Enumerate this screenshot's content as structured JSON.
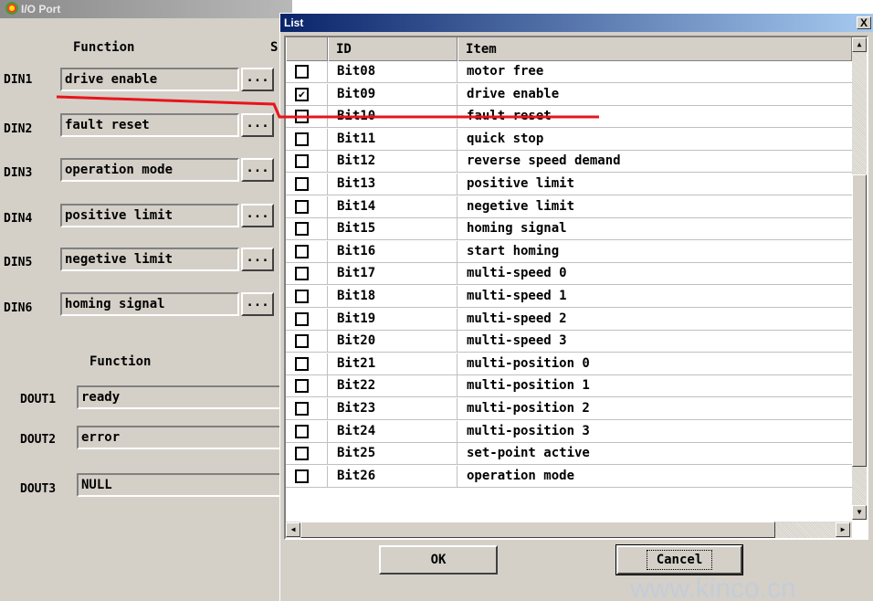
{
  "io_window": {
    "title": "I/O Port",
    "function_header": "Function",
    "second_header": "S",
    "inputs": [
      {
        "label": "DIN1",
        "value": "drive enable",
        "button": "..."
      },
      {
        "label": "DIN2",
        "value": "fault reset",
        "button": "..."
      },
      {
        "label": "DIN3",
        "value": "operation mode",
        "button": "..."
      },
      {
        "label": "DIN4",
        "value": "positive limit",
        "button": "..."
      },
      {
        "label": "DIN5",
        "value": "negetive limit",
        "button": "..."
      },
      {
        "label": "DIN6",
        "value": "homing signal",
        "button": "..."
      }
    ],
    "output_header": "Function",
    "outputs": [
      {
        "label": "DOUT1",
        "value": "ready"
      },
      {
        "label": "DOUT2",
        "value": "error"
      },
      {
        "label": "DOUT3",
        "value": "NULL"
      }
    ]
  },
  "list_dialog": {
    "title": "List",
    "close_label": "X",
    "columns": [
      "ID",
      "Item"
    ],
    "rows": [
      {
        "id": "Bit08",
        "item": "motor free",
        "checked": false
      },
      {
        "id": "Bit09",
        "item": "drive enable",
        "checked": true
      },
      {
        "id": "Bit10",
        "item": "fault reset",
        "checked": false
      },
      {
        "id": "Bit11",
        "item": "quick stop",
        "checked": false
      },
      {
        "id": "Bit12",
        "item": "reverse speed demand",
        "checked": false
      },
      {
        "id": "Bit13",
        "item": "positive limit",
        "checked": false
      },
      {
        "id": "Bit14",
        "item": "negetive limit",
        "checked": false
      },
      {
        "id": "Bit15",
        "item": "homing signal",
        "checked": false
      },
      {
        "id": "Bit16",
        "item": "start homing",
        "checked": false
      },
      {
        "id": "Bit17",
        "item": "multi-speed 0",
        "checked": false
      },
      {
        "id": "Bit18",
        "item": "multi-speed 1",
        "checked": false
      },
      {
        "id": "Bit19",
        "item": "multi-speed 2",
        "checked": false
      },
      {
        "id": "Bit20",
        "item": "multi-speed 3",
        "checked": false
      },
      {
        "id": "Bit21",
        "item": "multi-position 0",
        "checked": false
      },
      {
        "id": "Bit22",
        "item": "multi-position 1",
        "checked": false
      },
      {
        "id": "Bit23",
        "item": "multi-position 2",
        "checked": false
      },
      {
        "id": "Bit24",
        "item": "multi-position 3",
        "checked": false
      },
      {
        "id": "Bit25",
        "item": "set-point active",
        "checked": false
      },
      {
        "id": "Bit26",
        "item": "operation mode",
        "checked": false
      }
    ],
    "ok_label": "OK",
    "cancel_label": "Cancel"
  },
  "colors": {
    "annotation": "#e8141b",
    "face": "#d4d0c8",
    "title_active": "#0a246a"
  },
  "watermark": "www.kinco.cn"
}
